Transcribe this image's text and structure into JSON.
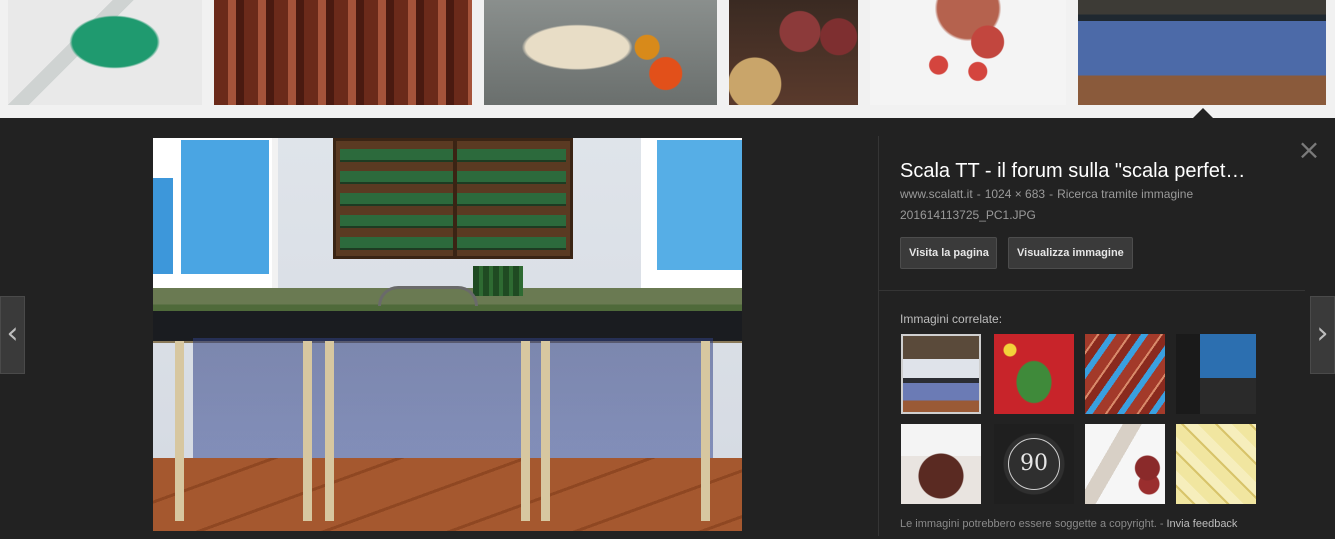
{
  "strip": {
    "thumbnails": [
      {
        "name": "valve-block"
      },
      {
        "name": "hanging-sausages"
      },
      {
        "name": "wrap-sandwich"
      },
      {
        "name": "salami-slices"
      },
      {
        "name": "salami-on-white"
      },
      {
        "name": "model-railway-selected"
      }
    ]
  },
  "preview": {
    "title": "Scala TT - il forum sulla \"scala perfet…",
    "site": "www.scalatt.it",
    "dimensions": "1024 × 683",
    "search_by_image": "Ricerca tramite immagine",
    "filename": "201614113725_PC1.JPG",
    "visit_page_label": "Visita la pagina",
    "view_image_label": "Visualizza immagine",
    "related_label": "Immagini correlate:",
    "copyright_note": "Le immagini potrebbero essere soggette a copyright.",
    "feedback_label": "Invia feedback",
    "meta_separator": "-"
  },
  "nav": {
    "prev_glyph": "‹",
    "next_glyph": "›",
    "close_glyph": "×"
  },
  "colors": {
    "panel_bg": "#222222",
    "strip_bg": "#f1f1f1",
    "title": "#ffffff",
    "meta": "#9a9a9a"
  }
}
